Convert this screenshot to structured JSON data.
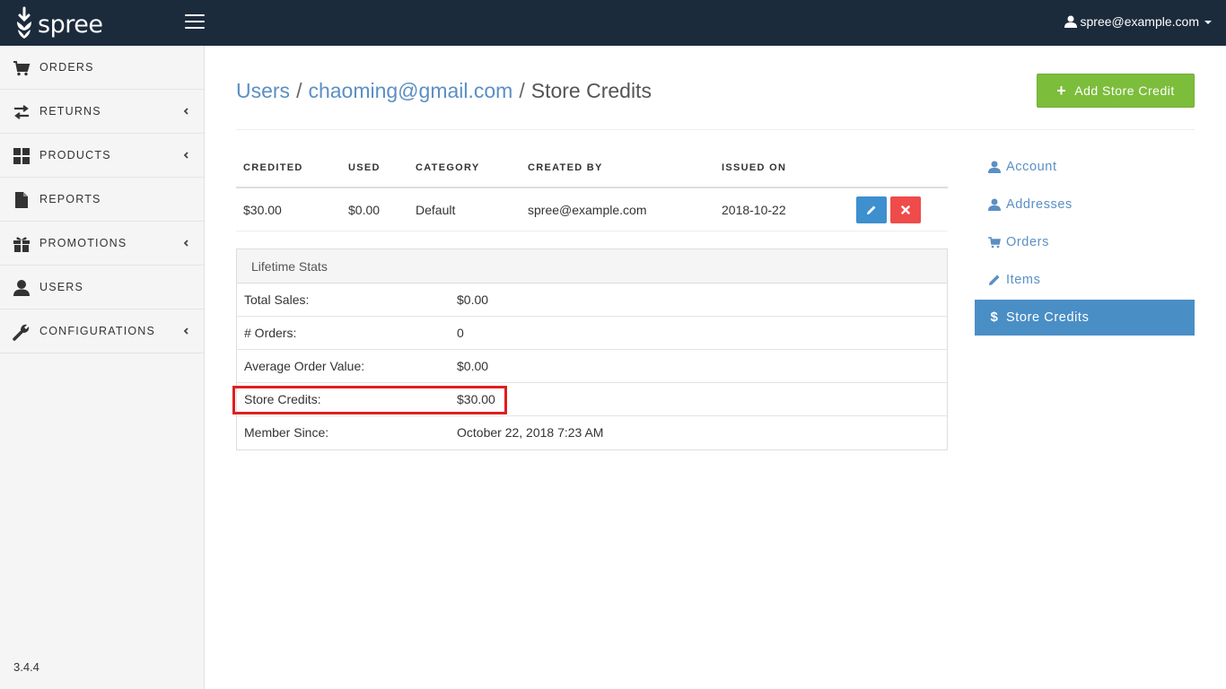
{
  "app": {
    "logo_text": "spree",
    "user_email": "spree@example.com",
    "version": "3.4.4"
  },
  "sidebar": {
    "items": [
      {
        "label": "ORDERS",
        "icon": "cart-icon",
        "has_chevron": false
      },
      {
        "label": "RETURNS",
        "icon": "transfer-icon",
        "has_chevron": true
      },
      {
        "label": "PRODUCTS",
        "icon": "grid-icon",
        "has_chevron": true
      },
      {
        "label": "REPORTS",
        "icon": "file-icon",
        "has_chevron": false
      },
      {
        "label": "PROMOTIONS",
        "icon": "gift-icon",
        "has_chevron": true
      },
      {
        "label": "USERS",
        "icon": "user-icon",
        "has_chevron": false
      },
      {
        "label": "CONFIGURATIONS",
        "icon": "wrench-icon",
        "has_chevron": true
      }
    ]
  },
  "breadcrumb": {
    "users": "Users",
    "sep": "/",
    "email": "chaoming@gmail.com",
    "current": "Store Credits"
  },
  "actions": {
    "add_store_credit": "Add Store Credit"
  },
  "credits_table": {
    "headers": [
      "CREDITED",
      "USED",
      "CATEGORY",
      "CREATED BY",
      "ISSUED ON"
    ],
    "rows": [
      {
        "credited": "$30.00",
        "used": "$0.00",
        "category": "Default",
        "created_by": "spree@example.com",
        "issued_on": "2018-10-22"
      }
    ]
  },
  "lifetime_stats": {
    "title": "Lifetime Stats",
    "rows": [
      {
        "label": "Total Sales:",
        "value": "$0.00"
      },
      {
        "label": "# Orders:",
        "value": "0"
      },
      {
        "label": "Average Order Value:",
        "value": "$0.00"
      },
      {
        "label": "Store Credits:",
        "value": "$30.00"
      },
      {
        "label": "Member Since:",
        "value": "October 22, 2018 7:23 AM"
      }
    ]
  },
  "right_nav": {
    "items": [
      {
        "label": "Account",
        "icon": "user-icon",
        "active": false
      },
      {
        "label": "Addresses",
        "icon": "user-icon",
        "active": false
      },
      {
        "label": "Orders",
        "icon": "cart-icon",
        "active": false
      },
      {
        "label": "Items",
        "icon": "pencil-icon",
        "active": false
      },
      {
        "label": "Store Credits",
        "icon": "dollar-icon",
        "active": true
      }
    ]
  },
  "colors": {
    "topbar": "#1c2b3c",
    "link": "#5b8fc4",
    "add_button": "#7cbd3c",
    "edit_button": "#3d8fce",
    "delete_button": "#ef4b4b",
    "active_nav": "#4a8ec6",
    "highlight_box": "#e01e1e"
  }
}
